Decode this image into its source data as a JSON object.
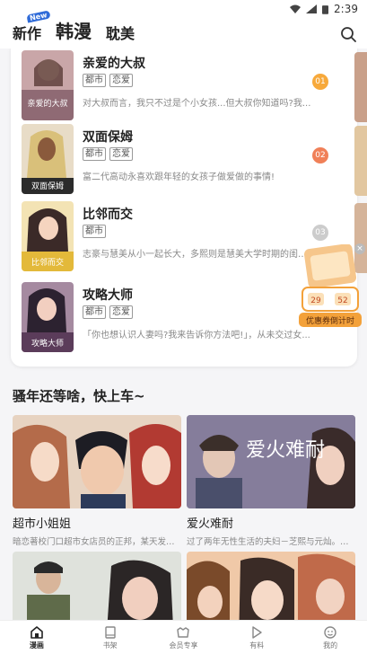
{
  "status_bar": {
    "time": "2:39"
  },
  "header": {
    "tabs": [
      {
        "label": "新作",
        "badge": "New"
      },
      {
        "label": "韩漫"
      },
      {
        "label": "耽美"
      }
    ]
  },
  "ranking": [
    {
      "title": "亲爱的大叔",
      "tags": [
        "都市",
        "恋爱"
      ],
      "desc": "对大叔而言，我只不过是个小女孩...但大叔你知道吗?我...",
      "num": "01",
      "color": "#f7a93b"
    },
    {
      "title": "双面保姆",
      "tags": [
        "都市",
        "恋爱"
      ],
      "desc": "富二代高动永喜欢跟年轻的女孩子做爱做的事情!",
      "num": "02",
      "color": "#f08058"
    },
    {
      "title": "比邻而交",
      "tags": [
        "都市"
      ],
      "desc": "志豪与慧美从小一起长大，多熙则是慧美大学时期的闺蜜...",
      "num": "03",
      "color": "#cccccc"
    },
    {
      "title": "攻略大师",
      "tags": [
        "都市",
        "恋爱"
      ],
      "desc": "「你也想认识人妻吗?我来告诉你方法吧!」，从未交过女...",
      "num": "",
      "color": ""
    }
  ],
  "promo": {
    "label": "优惠券倒计时",
    "n1": "29",
    "n2": "52",
    "close": "×"
  },
  "section": {
    "title": "骚年还等啥，快上车~"
  },
  "grid": [
    {
      "title": "超市小姐姐",
      "desc": "暗恋著校门口超市女店员的正邦，某天发现..."
    },
    {
      "title": "爱火难耐",
      "desc": "过了两年无性生活的夫妇－芝熙与元灿。随..."
    },
    {
      "title": "",
      "desc": ""
    },
    {
      "title": "",
      "desc": ""
    }
  ],
  "cover_texts": [
    "亲爱的大叔",
    "双面保姆",
    "比邻而交",
    "攻略大师"
  ],
  "grid_cover_text": "爱火难耐",
  "bottom_nav": [
    {
      "label": "漫画",
      "icon": "home-icon",
      "active": true
    },
    {
      "label": "书架",
      "icon": "bookshelf-icon"
    },
    {
      "label": "会员专享",
      "icon": "vip-icon"
    },
    {
      "label": "有料",
      "icon": "play-icon"
    },
    {
      "label": "我的",
      "icon": "profile-icon"
    }
  ]
}
